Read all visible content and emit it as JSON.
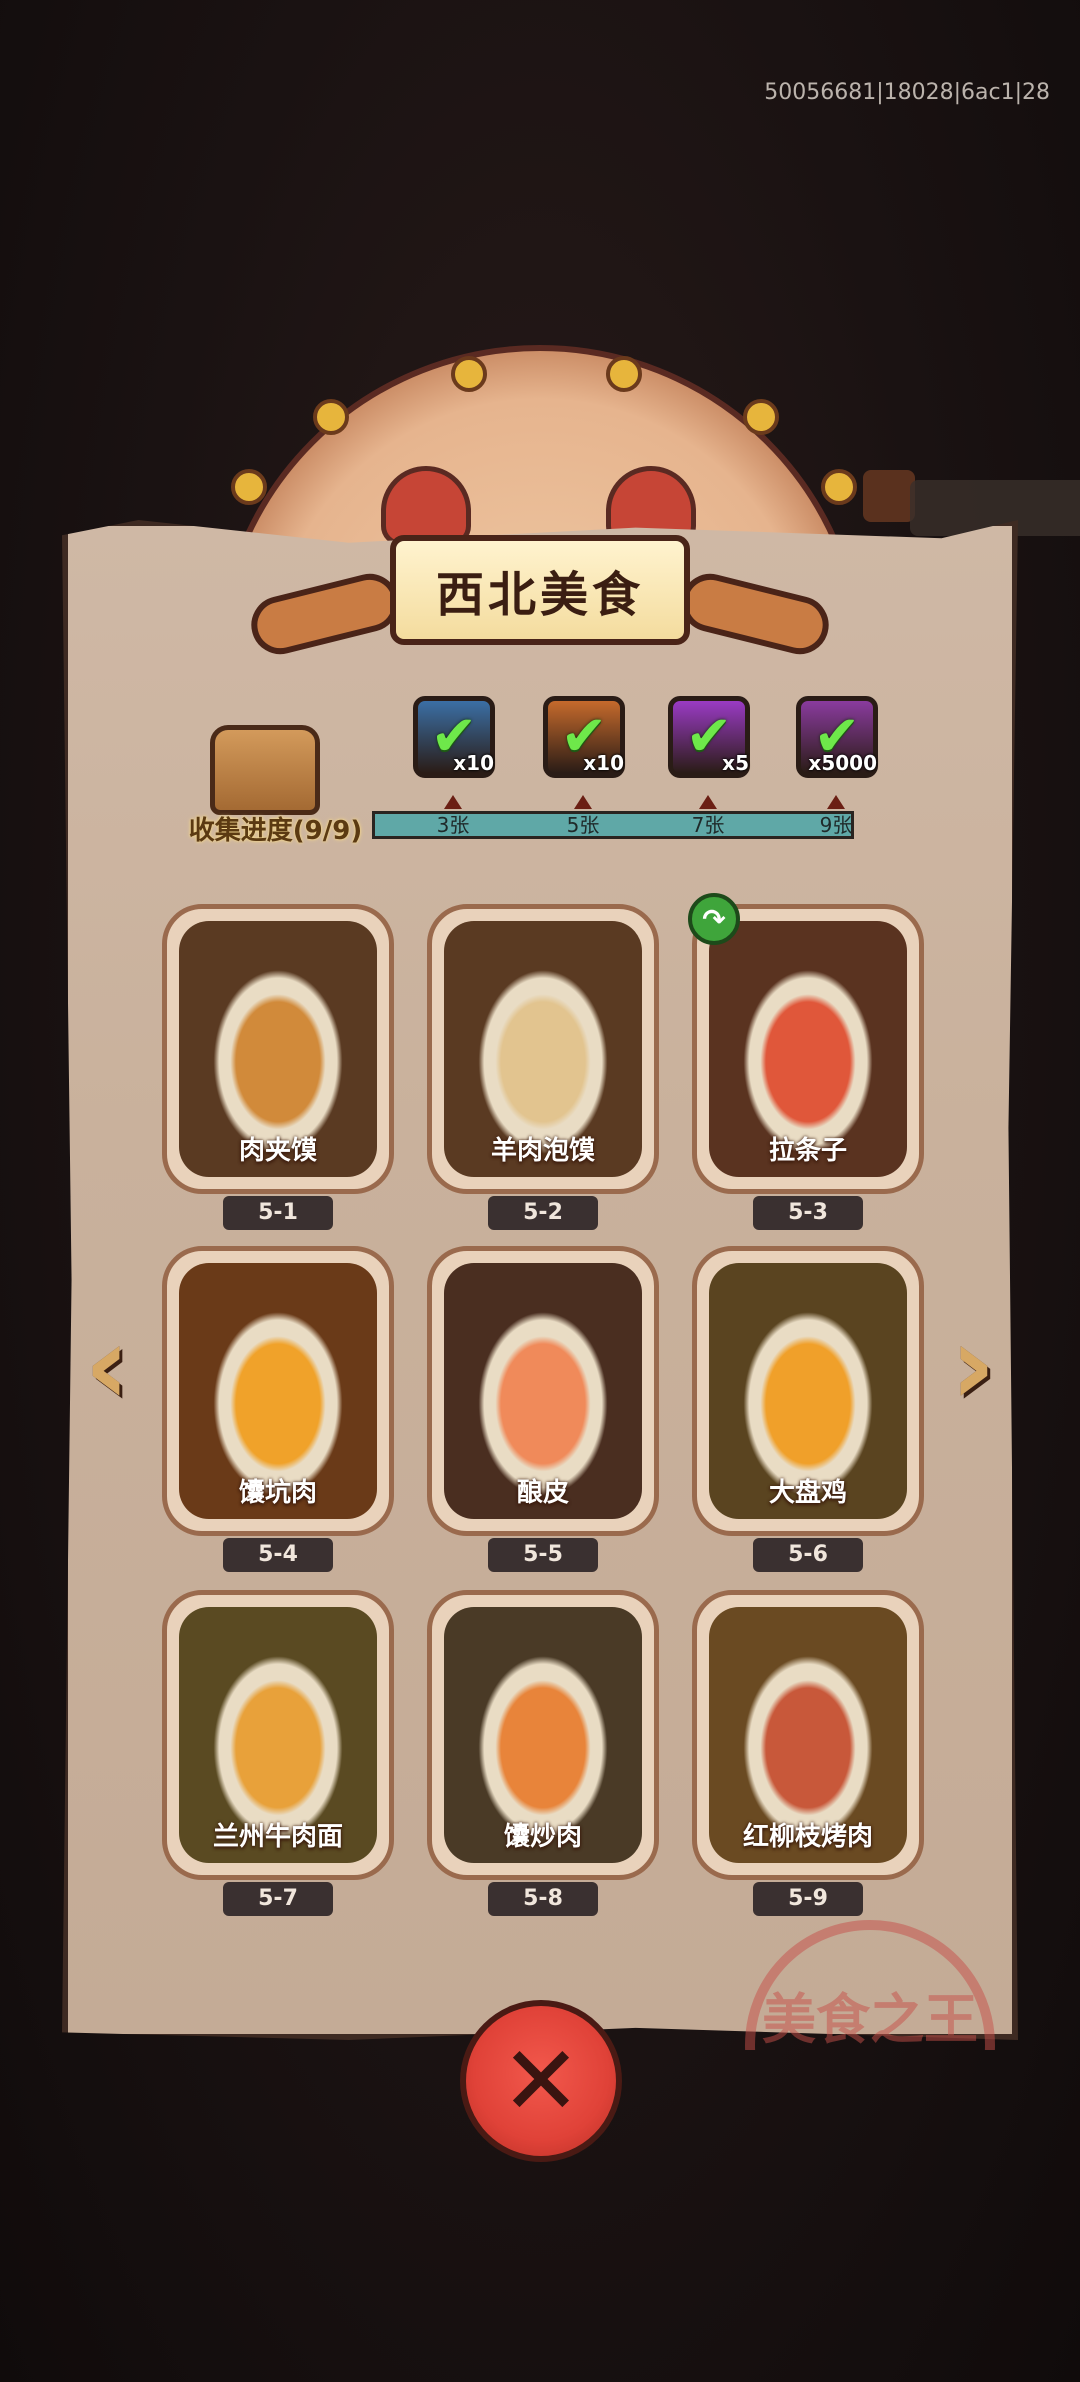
{
  "debug_id": "50056681|18028|6ac1|28",
  "panel": {
    "title": "西北美食"
  },
  "progress": {
    "label": "收集进度(9/9)",
    "collected": 9,
    "total": 9,
    "milestones": [
      {
        "label": "3张",
        "reward_qty": "x10",
        "icon": "blue-gem-chest-icon",
        "color": "#3b6fa5",
        "claimed": true
      },
      {
        "label": "5张",
        "reward_qty": "x10",
        "icon": "orange-key-icon",
        "color": "#c56a2c",
        "claimed": true
      },
      {
        "label": "7张",
        "reward_qty": "x5",
        "icon": "purple-orb-icon",
        "color": "#9a3bc4",
        "claimed": true
      },
      {
        "label": "9张",
        "reward_qty": "x5000",
        "icon": "purple-crystal-icon",
        "color": "#8a3b9e",
        "claimed": true
      }
    ]
  },
  "dishes": [
    {
      "name": "肉夹馍",
      "num": "5-1",
      "bg": "#5a3a22",
      "accent": "#d18a3a"
    },
    {
      "name": "羊肉泡馍",
      "num": "5-2",
      "bg": "#5a3a22",
      "accent": "#e2c48f"
    },
    {
      "name": "拉条子",
      "num": "5-3",
      "bg": "#5a3320",
      "accent": "#e0573a"
    },
    {
      "name": "馕坑肉",
      "num": "5-4",
      "bg": "#6a3a18",
      "accent": "#f0a22a"
    },
    {
      "name": "酿皮",
      "num": "5-5",
      "bg": "#4a2e20",
      "accent": "#f08a5a"
    },
    {
      "name": "大盘鸡",
      "num": "5-6",
      "bg": "#5a4420",
      "accent": "#f0a02a"
    },
    {
      "name": "兰州牛肉面",
      "num": "5-7",
      "bg": "#5a4a22",
      "accent": "#e8a13a"
    },
    {
      "name": "馕炒肉",
      "num": "5-8",
      "bg": "#4a3a26",
      "accent": "#e8843a"
    },
    {
      "name": "红柳枝烤肉",
      "num": "5-9",
      "bg": "#6a4a22",
      "accent": "#c8583a"
    }
  ],
  "nav": {
    "prev": "‹",
    "next": "›"
  },
  "close": {
    "label": "✕"
  },
  "share": {
    "label": "↷"
  },
  "seal_text": "美食之王"
}
